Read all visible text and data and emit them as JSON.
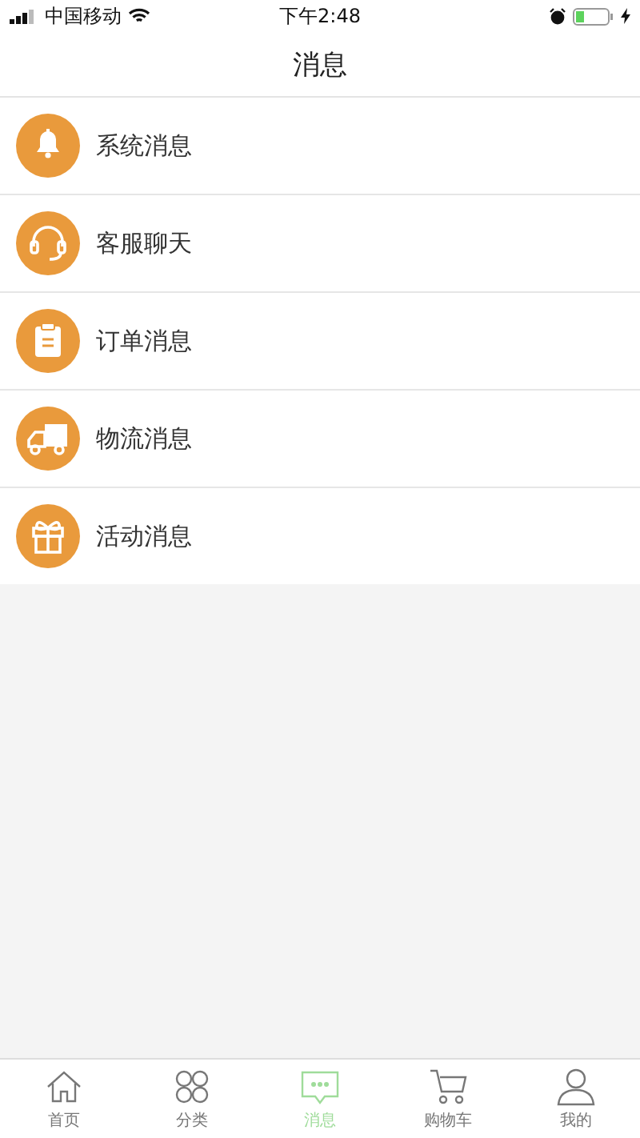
{
  "status_bar": {
    "carrier": "中国移动",
    "time": "下午2:48"
  },
  "nav_bar": {
    "title": "消息"
  },
  "messages": [
    {
      "kind": "bell",
      "label": "系统消息"
    },
    {
      "kind": "headset",
      "label": "客服聊天"
    },
    {
      "kind": "clipboard",
      "label": "订单消息"
    },
    {
      "kind": "truck",
      "label": "物流消息"
    },
    {
      "kind": "gift",
      "label": "活动消息"
    }
  ],
  "tab_bar": [
    {
      "kind": "home",
      "label": "首页",
      "selected": false
    },
    {
      "kind": "grid",
      "label": "分类",
      "selected": false
    },
    {
      "kind": "chat",
      "label": "消息",
      "selected": true
    },
    {
      "kind": "cart",
      "label": "购物车",
      "selected": false
    },
    {
      "kind": "person",
      "label": "我的",
      "selected": false
    }
  ]
}
